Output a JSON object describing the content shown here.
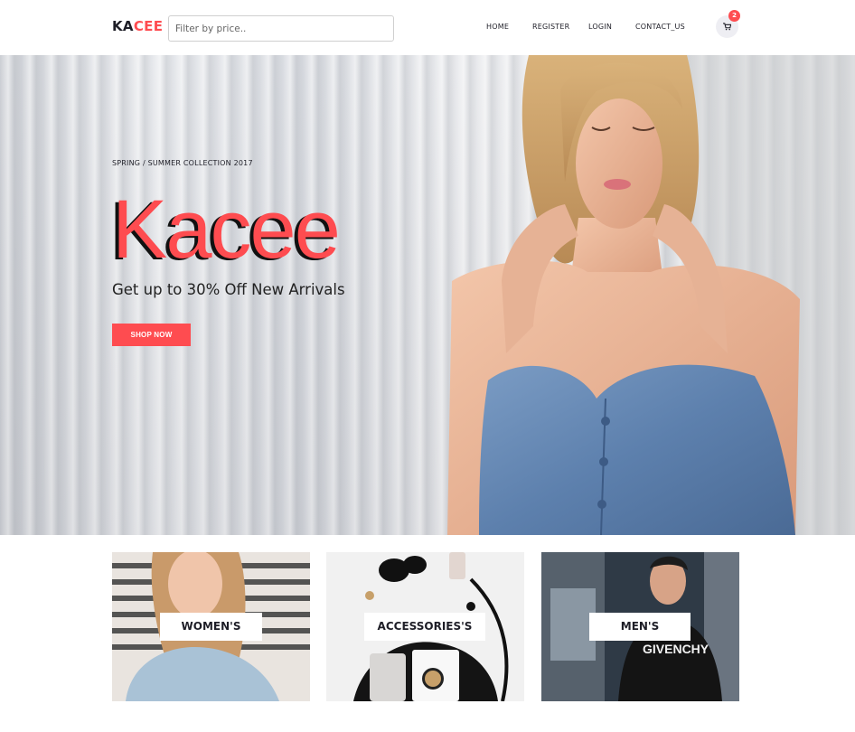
{
  "header": {
    "logo_prefix": "KA",
    "logo_accent": "CEE",
    "search_placeholder": "Filter by price..",
    "nav": [
      {
        "label": "HOME"
      },
      {
        "label": "REGISTER"
      },
      {
        "label": "LOGIN"
      },
      {
        "label": "CONTACT_US"
      }
    ],
    "cart_count": "2",
    "cart_icon": "shopping-cart-icon"
  },
  "hero": {
    "subtitle": "SPRING / SUMMER COLLECTION 2017",
    "brand": "Kacee",
    "tagline": "Get up to 30% Off New Arrivals",
    "button_label": "SHOP NOW"
  },
  "categories": [
    {
      "label": "WOMEN'S"
    },
    {
      "label": "ACCESSORIES'S"
    },
    {
      "label": "MEN'S"
    }
  ],
  "colors": {
    "accent": "#fe4c50",
    "text": "#1e1e27",
    "cart_bg": "#eeeef3"
  }
}
